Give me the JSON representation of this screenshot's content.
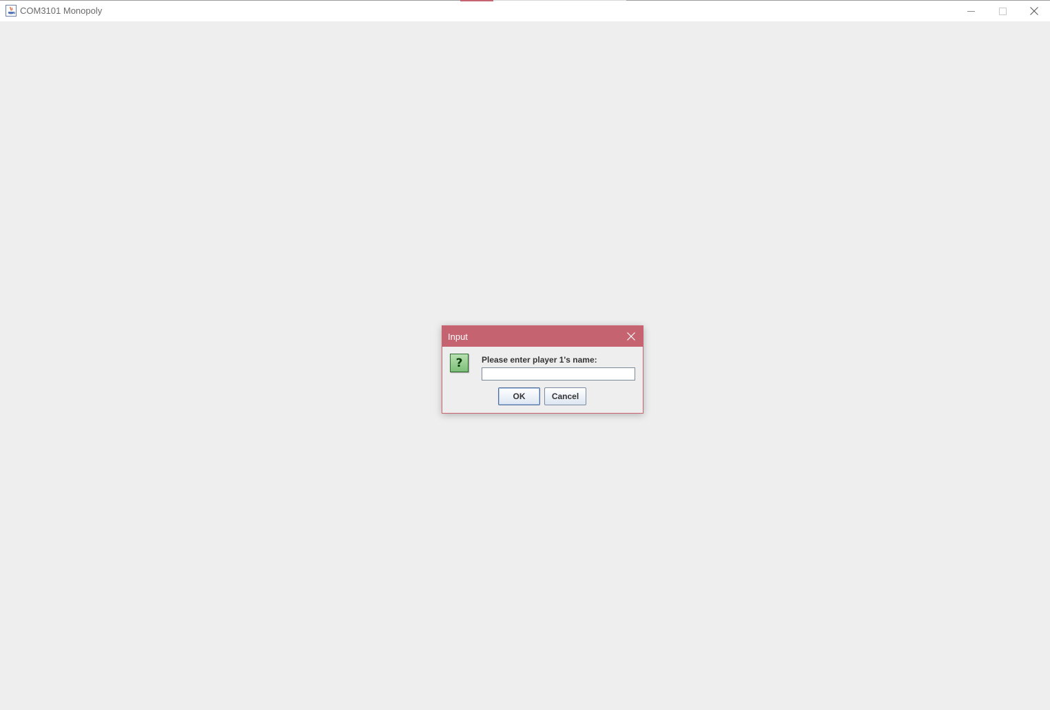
{
  "window": {
    "title": "COM3101 Monopoly",
    "controls": {
      "minimize_icon": "minimize-icon",
      "maximize_icon": "maximize-icon",
      "close_icon": "close-icon"
    },
    "background_color": "#eeeeee"
  },
  "dialog": {
    "title": "Input",
    "close_icon": "close-icon",
    "icon": "question-icon",
    "icon_glyph": "?",
    "prompt": "Please enter player 1's name:",
    "input_value": "",
    "ok_label": "OK",
    "cancel_label": "Cancel",
    "accent_color": "#c56470"
  }
}
